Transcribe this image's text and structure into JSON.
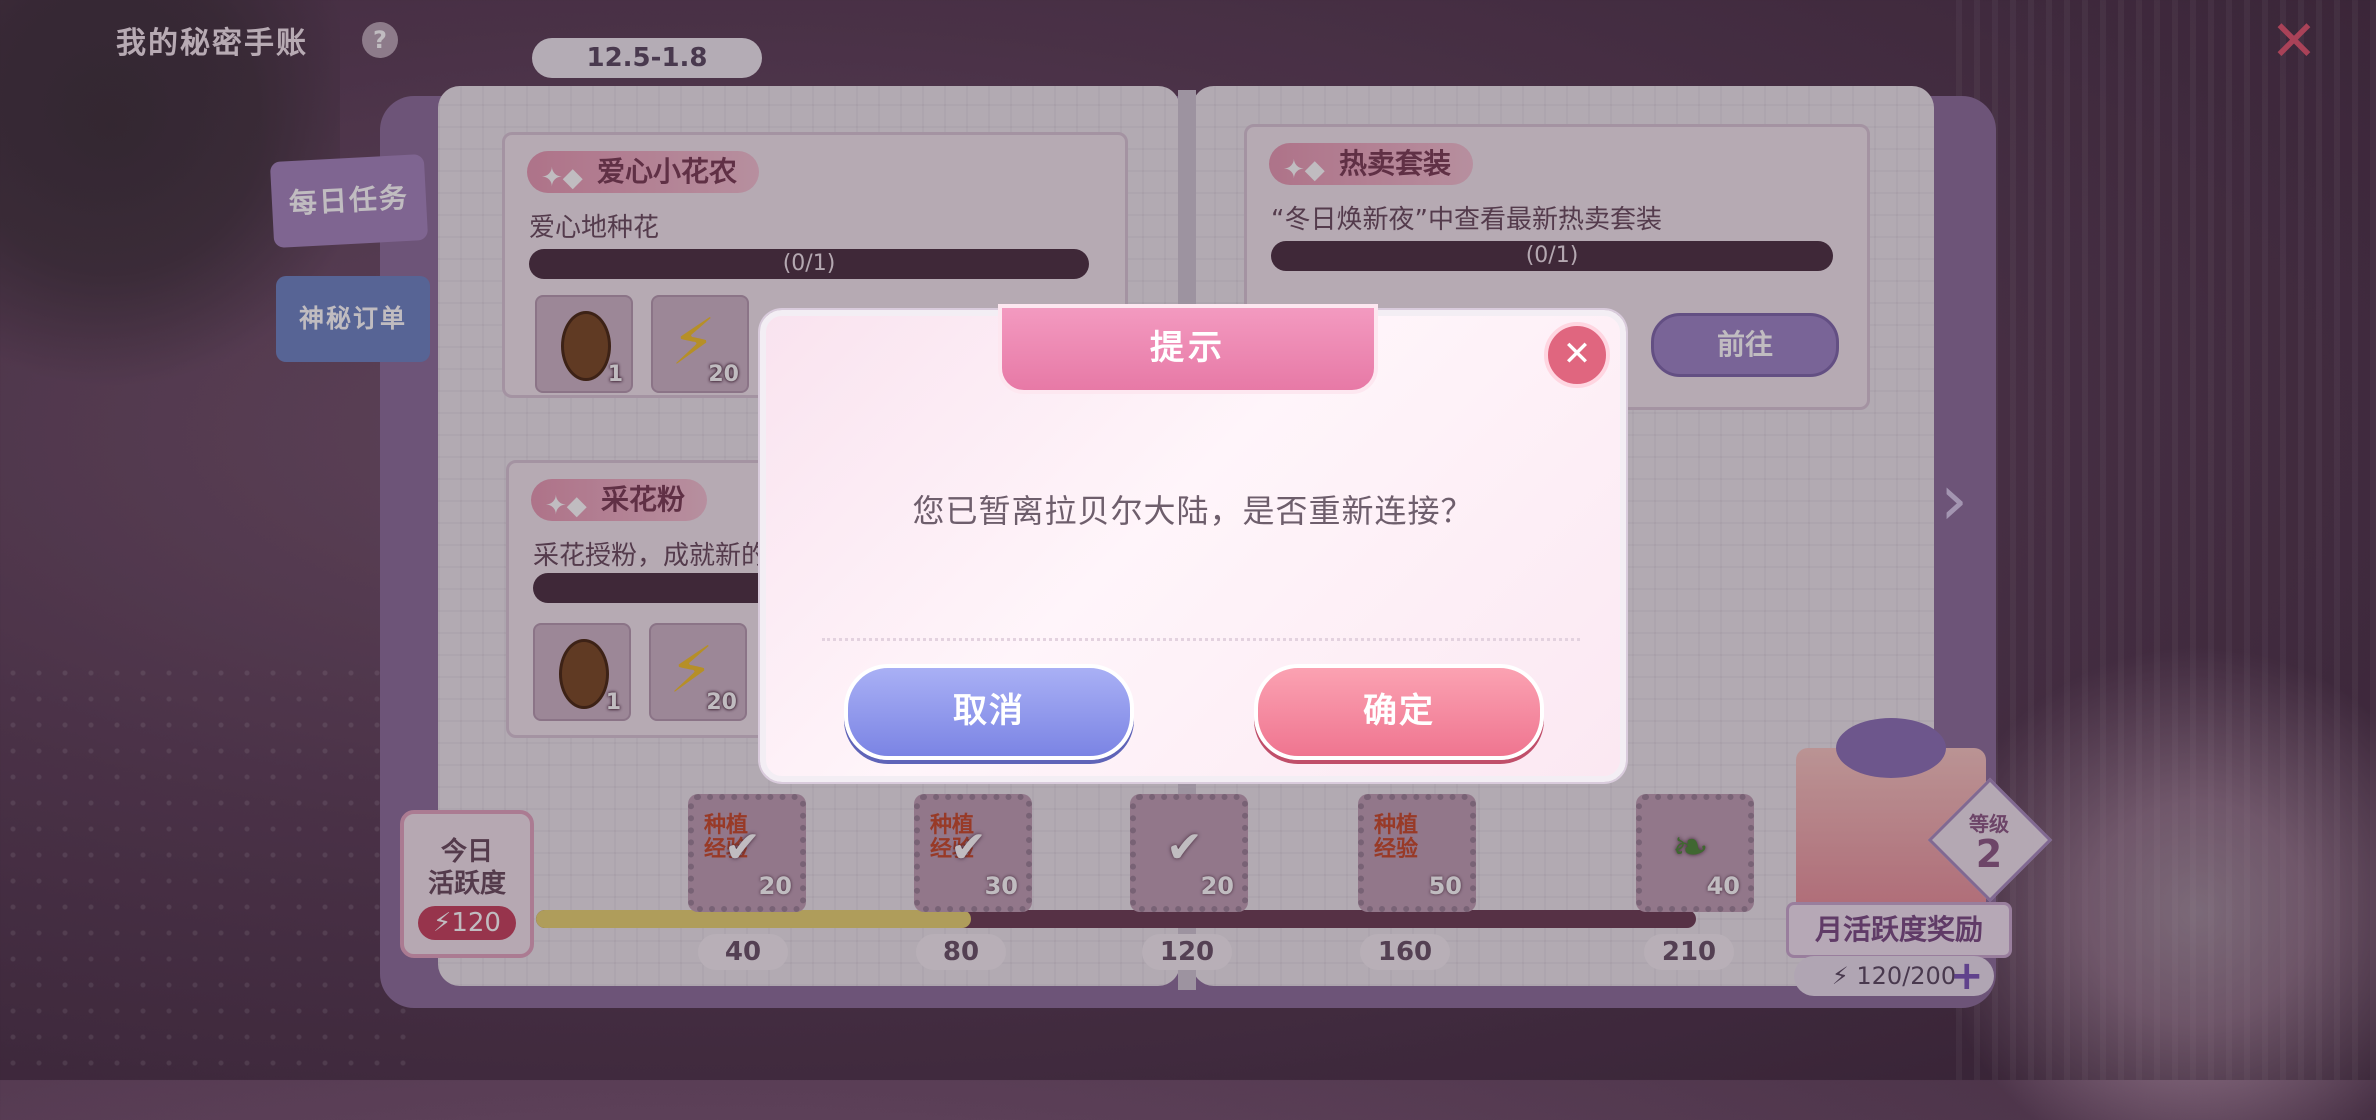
{
  "header": {
    "title": "我的秘密手账",
    "help_icon_glyph": "?",
    "date_range": "12.5-1.8",
    "close_icon": "close-flower-icon"
  },
  "side_tabs": [
    {
      "label": "每日任务",
      "active": true
    },
    {
      "label": "神秘订单",
      "active": false
    }
  ],
  "tasks": [
    {
      "name": "爱心小花农",
      "desc": "爱心地种花",
      "progress": "(0/1)",
      "rewards": [
        {
          "icon": "seed-icon",
          "count": "1"
        },
        {
          "icon": "lightning-icon",
          "count": "20"
        }
      ]
    },
    {
      "name": "热卖套装",
      "desc": "“冬日焕新夜”中查看最新热卖套装",
      "progress": "(0/1)",
      "button": "前往"
    },
    {
      "name": "采花粉",
      "desc": "采花授粉，成就新的",
      "rewards": [
        {
          "icon": "seed-icon",
          "count": "1"
        },
        {
          "icon": "lightning-icon",
          "count": "20"
        }
      ]
    }
  ],
  "activity": {
    "today_label_1": "今日",
    "today_label_2": "活跃度",
    "today_value": "120",
    "progress_fraction": 0.375,
    "milestones": [
      {
        "threshold": "40",
        "label": "种植经验",
        "count": "20",
        "claimed": true
      },
      {
        "threshold": "80",
        "label": "种植经验",
        "count": "30",
        "claimed": true
      },
      {
        "threshold": "120",
        "label": "",
        "count": "20",
        "claimed": true
      },
      {
        "threshold": "160",
        "label": "种植经验",
        "count": "50",
        "claimed": false
      },
      {
        "threshold": "210",
        "label": "",
        "count": "40",
        "claimed": false
      }
    ]
  },
  "monthly": {
    "level_label": "等级",
    "level": "2",
    "title": "月活跃度奖励",
    "progress": "120/200"
  },
  "dialog": {
    "title": "提示",
    "message": "您已暂离拉贝尔大陆，是否重新连接？",
    "cancel": "取消",
    "confirm": "确定"
  },
  "colors": {
    "dialog_header": "#e779a6",
    "cancel_button": "#7b84e4",
    "confirm_button": "#ef7590",
    "progress_fill": "#e8d573"
  }
}
